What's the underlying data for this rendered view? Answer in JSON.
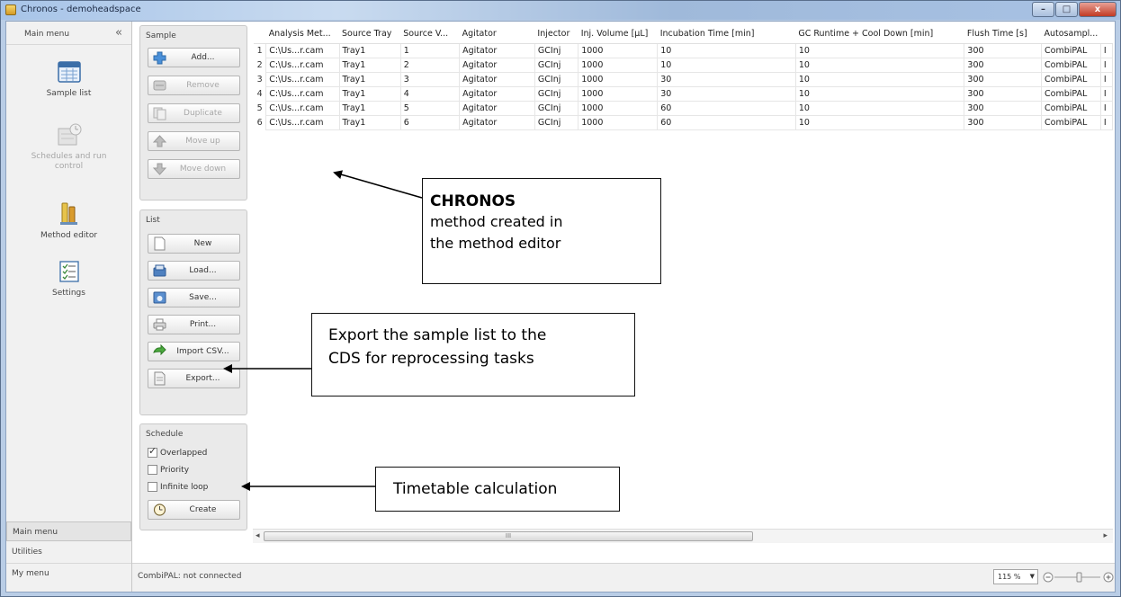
{
  "window": {
    "title": "Chronos - demoheadspace",
    "minimize_label": "–",
    "maximize_label": "□",
    "close_label": "x"
  },
  "nav": {
    "header": "Main menu",
    "collapse": "«",
    "items": [
      {
        "label": "Sample list",
        "icon": "sample-list-icon",
        "enabled": true
      },
      {
        "label": "Schedules and run control",
        "icon": "schedules-icon",
        "enabled": false
      },
      {
        "label": "Method editor",
        "icon": "method-editor-icon",
        "enabled": true
      },
      {
        "label": "Settings",
        "icon": "settings-icon",
        "enabled": true
      }
    ],
    "bottom": [
      "Main menu",
      "Utilities",
      "My menu"
    ]
  },
  "panel": {
    "sample": {
      "title": "Sample",
      "buttons": [
        {
          "label": "Add...",
          "enabled": true
        },
        {
          "label": "Remove",
          "enabled": false
        },
        {
          "label": "Duplicate",
          "enabled": false
        },
        {
          "label": "Move up",
          "enabled": false
        },
        {
          "label": "Move down",
          "enabled": false
        }
      ]
    },
    "list": {
      "title": "List",
      "buttons": [
        "New",
        "Load...",
        "Save...",
        "Print...",
        "Import CSV...",
        "Export..."
      ]
    },
    "schedule": {
      "title": "Schedule",
      "checks": [
        {
          "label": "Overlapped",
          "checked": true
        },
        {
          "label": "Priority",
          "checked": false
        },
        {
          "label": "Infinite loop",
          "checked": false
        }
      ],
      "create_label": "Create"
    }
  },
  "table": {
    "columns": [
      "Analysis Met...",
      "Source Tray",
      "Source V...",
      "Agitator",
      "Injector",
      "Inj. Volume [µL]",
      "Incubation Time [min]",
      "GC Runtime + Cool Down [min]",
      "Flush Time [s]",
      "Autosampl...",
      ""
    ],
    "rows": [
      [
        "1",
        "C:\\Us...r.cam",
        "Tray1",
        "1",
        "Agitator",
        "GCInj",
        "1000",
        "10",
        "10",
        "300",
        "CombiPAL",
        "I"
      ],
      [
        "2",
        "C:\\Us...r.cam",
        "Tray1",
        "2",
        "Agitator",
        "GCInj",
        "1000",
        "10",
        "10",
        "300",
        "CombiPAL",
        "I"
      ],
      [
        "3",
        "C:\\Us...r.cam",
        "Tray1",
        "3",
        "Agitator",
        "GCInj",
        "1000",
        "30",
        "10",
        "300",
        "CombiPAL",
        "I"
      ],
      [
        "4",
        "C:\\Us...r.cam",
        "Tray1",
        "4",
        "Agitator",
        "GCInj",
        "1000",
        "30",
        "10",
        "300",
        "CombiPAL",
        "I"
      ],
      [
        "5",
        "C:\\Us...r.cam",
        "Tray1",
        "5",
        "Agitator",
        "GCInj",
        "1000",
        "60",
        "10",
        "300",
        "CombiPAL",
        "I"
      ],
      [
        "6",
        "C:\\Us...r.cam",
        "Tray1",
        "6",
        "Agitator",
        "GCInj",
        "1000",
        "60",
        "10",
        "300",
        "CombiPAL",
        "I"
      ]
    ],
    "scroll_grip": "III"
  },
  "status": {
    "text": "CombiPAL: not connected",
    "zoom": "115 %"
  },
  "callouts": {
    "method": {
      "title": "CHRONOS",
      "line1": "method created in",
      "line2": "the method editor"
    },
    "export": {
      "line1": "Export the sample list to the",
      "line2": "CDS for reprocessing tasks"
    },
    "timetable": {
      "text": "Timetable calculation"
    }
  }
}
